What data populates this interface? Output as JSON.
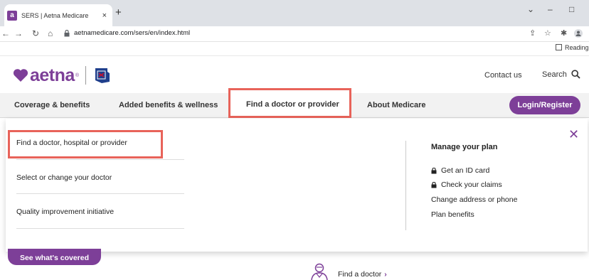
{
  "browser": {
    "tab_title": "SERS | Aetna Medicare",
    "tab_favicon_letter": "a",
    "tab_close": "×",
    "new_tab": "+",
    "minimize": "–",
    "maximize": "□",
    "collapse": "⌄",
    "url": "aetnamedicare.com/sers/en/index.html",
    "reading_list": "Reading"
  },
  "header": {
    "logo_text": "aetna",
    "logo_reg": "®",
    "contact_label": "Contact us",
    "search_label": "Search"
  },
  "mainnav": {
    "items": [
      {
        "label": "Coverage & benefits"
      },
      {
        "label": "Added benefits & wellness"
      },
      {
        "label": "Find a doctor or provider"
      },
      {
        "label": "About Medicare"
      }
    ],
    "login_label": "Login/Register"
  },
  "dropdown": {
    "items": [
      {
        "label": "Find a doctor, hospital or provider"
      },
      {
        "label": "Select or change your doctor"
      },
      {
        "label": "Quality improvement initiative"
      }
    ],
    "manage": {
      "title": "Manage your plan",
      "links": [
        {
          "label": "Get an ID card"
        },
        {
          "label": "Check your claims"
        },
        {
          "label": "Change address or phone"
        },
        {
          "label": "Plan benefits"
        }
      ]
    },
    "close": "✕"
  },
  "below": {
    "see_covered": "See what's covered",
    "find_doctor": "Find a doctor",
    "chevron": "›"
  },
  "colors": {
    "brand_purple": "#7d3f98",
    "highlight_red": "#e8635a"
  }
}
